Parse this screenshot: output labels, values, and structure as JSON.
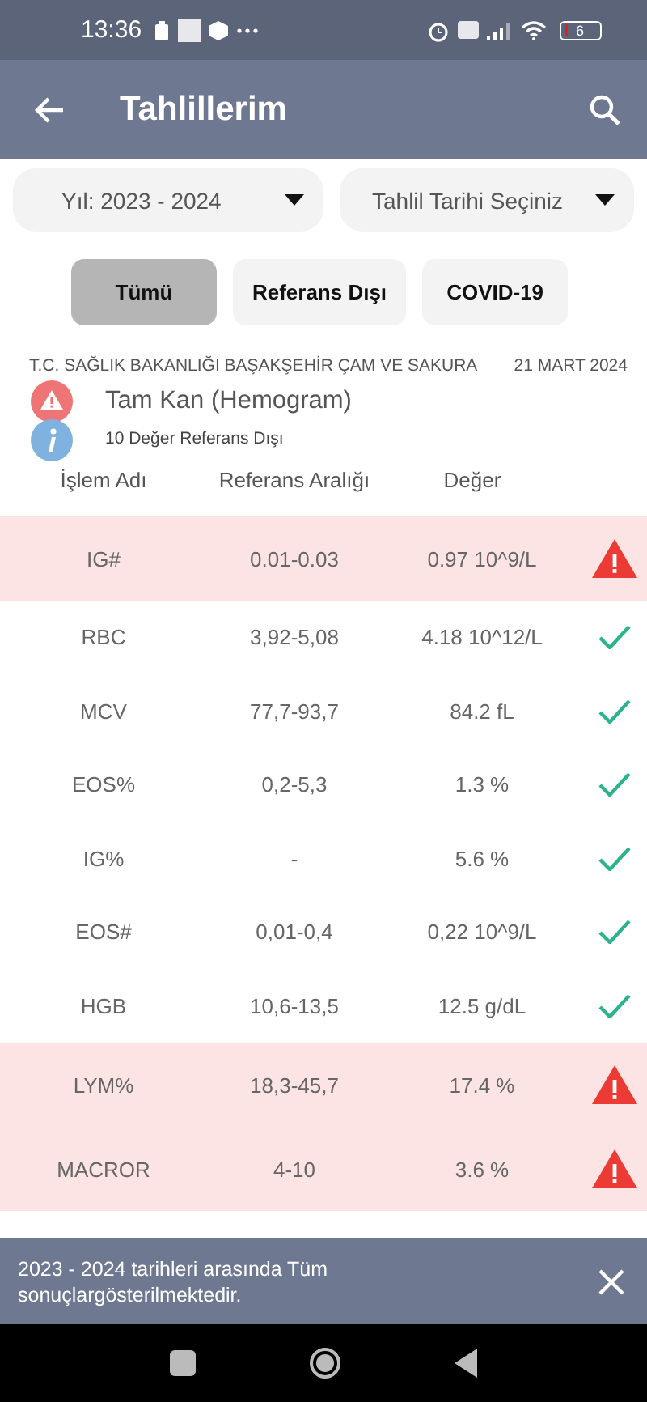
{
  "status_bar": {
    "time": "13:36",
    "battery": "6"
  },
  "app_bar": {
    "title": "Tahlillerim"
  },
  "dropdowns": [
    {
      "value": "Yıl: 2023 - 2024"
    },
    {
      "value": "Tahlil Tarihi Seçiniz"
    }
  ],
  "filters": [
    {
      "label": "Tümü",
      "selected": true
    },
    {
      "label": "Referans Dışı",
      "selected": false
    },
    {
      "label": "COVID-19",
      "selected": false
    }
  ],
  "report": {
    "hospital": "T.C. SAĞLIK BAKANLIĞI BAŞAKŞEHİR ÇAM VE SAKURA",
    "date": "21 MART 2024",
    "test_name": "Tam Kan (Hemogram)",
    "summary": "10 Değer Referans Dışı"
  },
  "table": {
    "columns": [
      "İşlem Adı",
      "Referans Aralığı",
      "Değer"
    ],
    "rows": [
      {
        "name": "IG#",
        "range": "0.01-0.03",
        "value": "0.97 10^9/L",
        "out_of_range": true
      },
      {
        "name": "RBC",
        "range": "3,92-5,08",
        "value": "4.18 10^12/L",
        "out_of_range": false
      },
      {
        "name": "MCV",
        "range": "77,7-93,7",
        "value": "84.2 fL",
        "out_of_range": false
      },
      {
        "name": "EOS%",
        "range": "0,2-5,3",
        "value": "1.3 %",
        "out_of_range": false
      },
      {
        "name": "IG%",
        "range": "-",
        "value": "5.6 %",
        "out_of_range": false
      },
      {
        "name": "EOS#",
        "range": "0,01-0,4",
        "value": "0,22 10^9/L",
        "out_of_range": false
      },
      {
        "name": "HGB",
        "range": "10,6-13,5",
        "value": "12.5 g/dL",
        "out_of_range": false
      },
      {
        "name": "LYM%",
        "range": "18,3-45,7",
        "value": "17.4 %",
        "out_of_range": true
      },
      {
        "name": "MACROR",
        "range": "4-10",
        "value": "3.6 %",
        "out_of_range": true
      }
    ]
  },
  "snackbar": {
    "message": "2023 - 2024 tarihleri arasında Tüm sonuçlargösterilmektedir."
  }
}
